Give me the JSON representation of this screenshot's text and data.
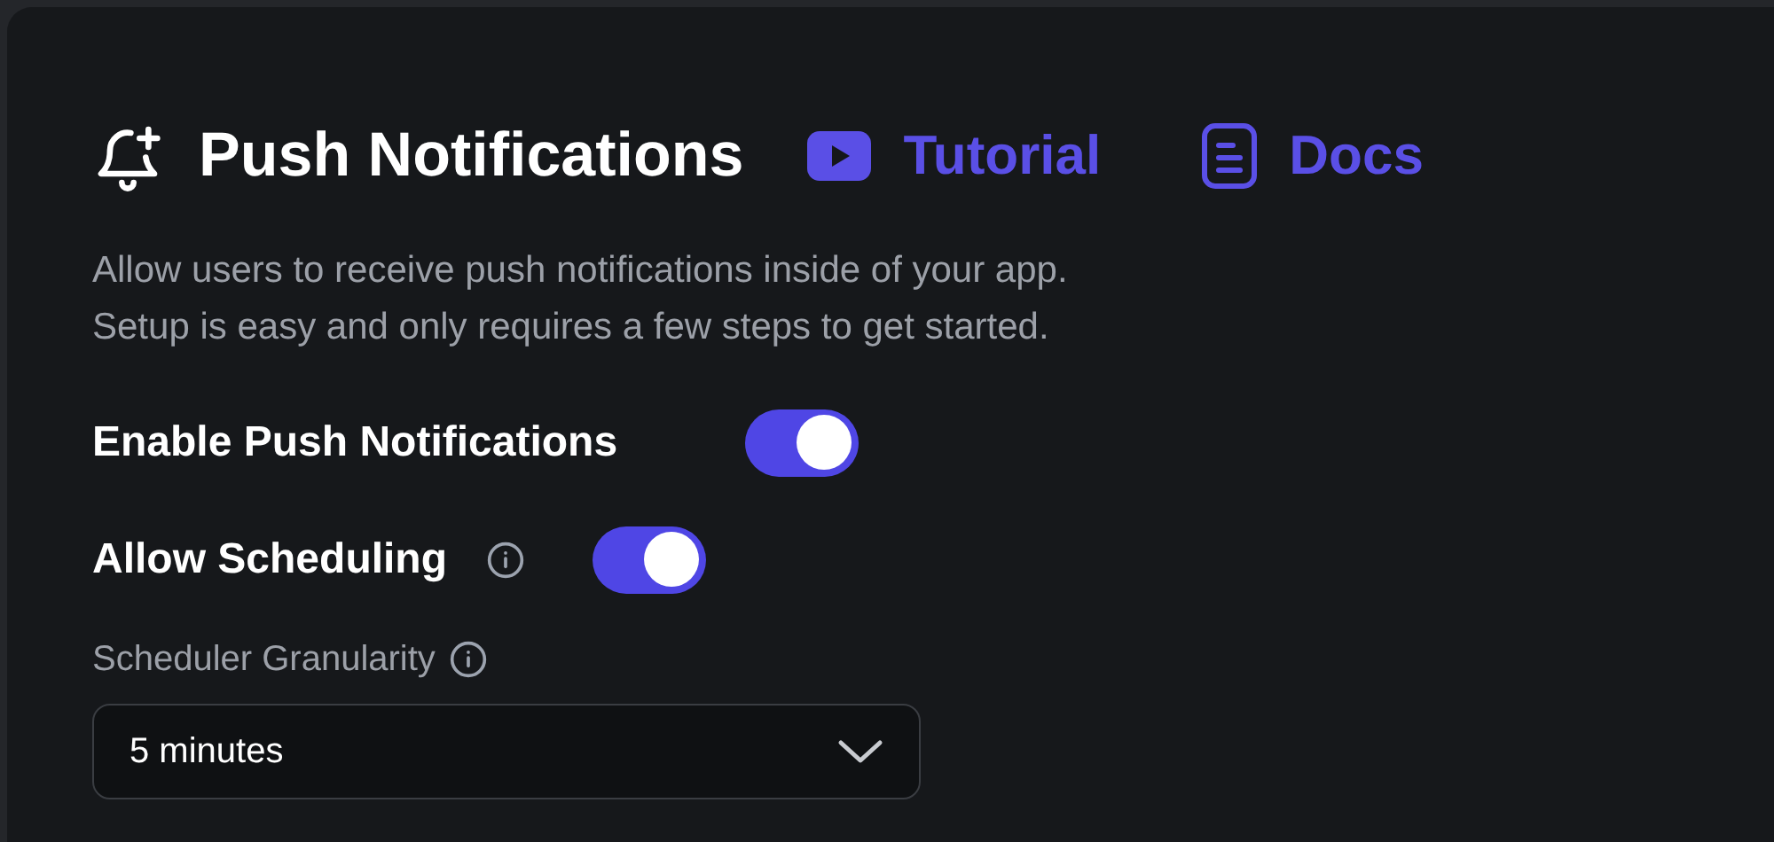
{
  "header": {
    "title": "Push Notifications",
    "links": [
      {
        "kind": "video",
        "label": "Tutorial"
      },
      {
        "kind": "docs",
        "label": "Docs"
      }
    ]
  },
  "description": [
    "Allow users to receive push notifications inside of your app.",
    "Setup is easy and only requires a few steps to get started."
  ],
  "toggles": [
    {
      "label": "Enable Push Notifications",
      "info": false,
      "on": true
    },
    {
      "label": "Allow Scheduling",
      "info": true,
      "on": true
    }
  ],
  "granularity": {
    "label": "Scheduler Granularity",
    "info": true,
    "value": "5 minutes"
  }
}
